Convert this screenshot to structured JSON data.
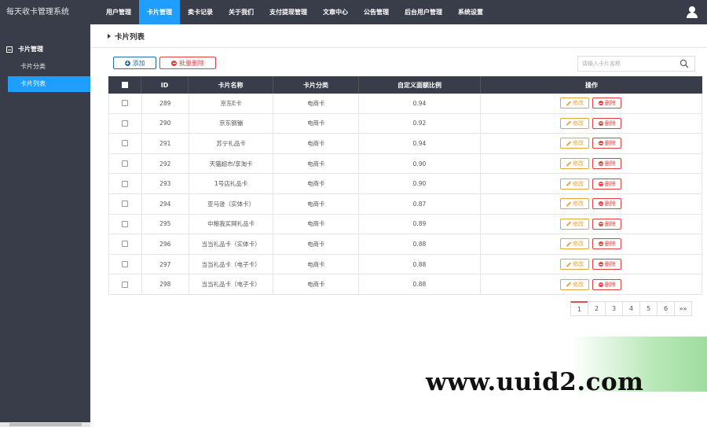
{
  "app": {
    "title": "每天收卡管理系统"
  },
  "nav": {
    "items": [
      {
        "label": "用户管理",
        "active": false
      },
      {
        "label": "卡片管理",
        "active": true
      },
      {
        "label": "卖卡记录",
        "active": false
      },
      {
        "label": "关于我们",
        "active": false
      },
      {
        "label": "支付提现管理",
        "active": false
      },
      {
        "label": "文章中心",
        "active": false
      },
      {
        "label": "公告管理",
        "active": false
      },
      {
        "label": "后台用户管理",
        "active": false
      },
      {
        "label": "系统设置",
        "active": false
      }
    ],
    "user_icon": "user-icon"
  },
  "sidebar": {
    "group_label": "卡片管理",
    "items": [
      {
        "label": "卡片分类",
        "active": false
      },
      {
        "label": "卡片列表",
        "active": true
      }
    ]
  },
  "page": {
    "title": "卡片列表"
  },
  "toolbar": {
    "add_label": "添加",
    "batch_delete_label": "批量删除"
  },
  "search": {
    "placeholder": "请输入卡片名称"
  },
  "table": {
    "headers": {
      "id": "ID",
      "name": "卡片名称",
      "category": "卡片分类",
      "ratio": "自定义面额比例",
      "ops": "操作"
    },
    "edit_label": "修改",
    "delete_label": "删除",
    "rows": [
      {
        "id": "289",
        "name": "京东E卡",
        "category": "电商卡",
        "ratio": "0.94"
      },
      {
        "id": "290",
        "name": "京东钢镚",
        "category": "电商卡",
        "ratio": "0.92"
      },
      {
        "id": "291",
        "name": "苏宁礼品卡",
        "category": "电商卡",
        "ratio": "0.94"
      },
      {
        "id": "292",
        "name": "天猫超市/享淘卡",
        "category": "电商卡",
        "ratio": "0.90"
      },
      {
        "id": "293",
        "name": "1号店礼品卡",
        "category": "电商卡",
        "ratio": "0.90"
      },
      {
        "id": "294",
        "name": "亚马逊（实体卡）",
        "category": "电商卡",
        "ratio": "0.87"
      },
      {
        "id": "295",
        "name": "中粮我买网礼品卡",
        "category": "电商卡",
        "ratio": "0.89"
      },
      {
        "id": "296",
        "name": "当当礼品卡（实体卡）",
        "category": "电商卡",
        "ratio": "0.88"
      },
      {
        "id": "297",
        "name": "当当礼品卡（电子卡）",
        "category": "电商卡",
        "ratio": "0.88"
      },
      {
        "id": "298",
        "name": "当当礼品卡（电子卡）",
        "category": "电商卡",
        "ratio": "0.88"
      }
    ]
  },
  "pagination": {
    "pages": [
      "1",
      "2",
      "3",
      "4",
      "5",
      "6"
    ],
    "current": "1",
    "next_label": "»»"
  },
  "watermark": {
    "text": "www.uuid2.com"
  },
  "colors": {
    "topbar": "#393d49",
    "accent": "#1e9fff",
    "edit": "#e8a33b",
    "delete": "#e3413d",
    "add": "#1e6fb8"
  }
}
